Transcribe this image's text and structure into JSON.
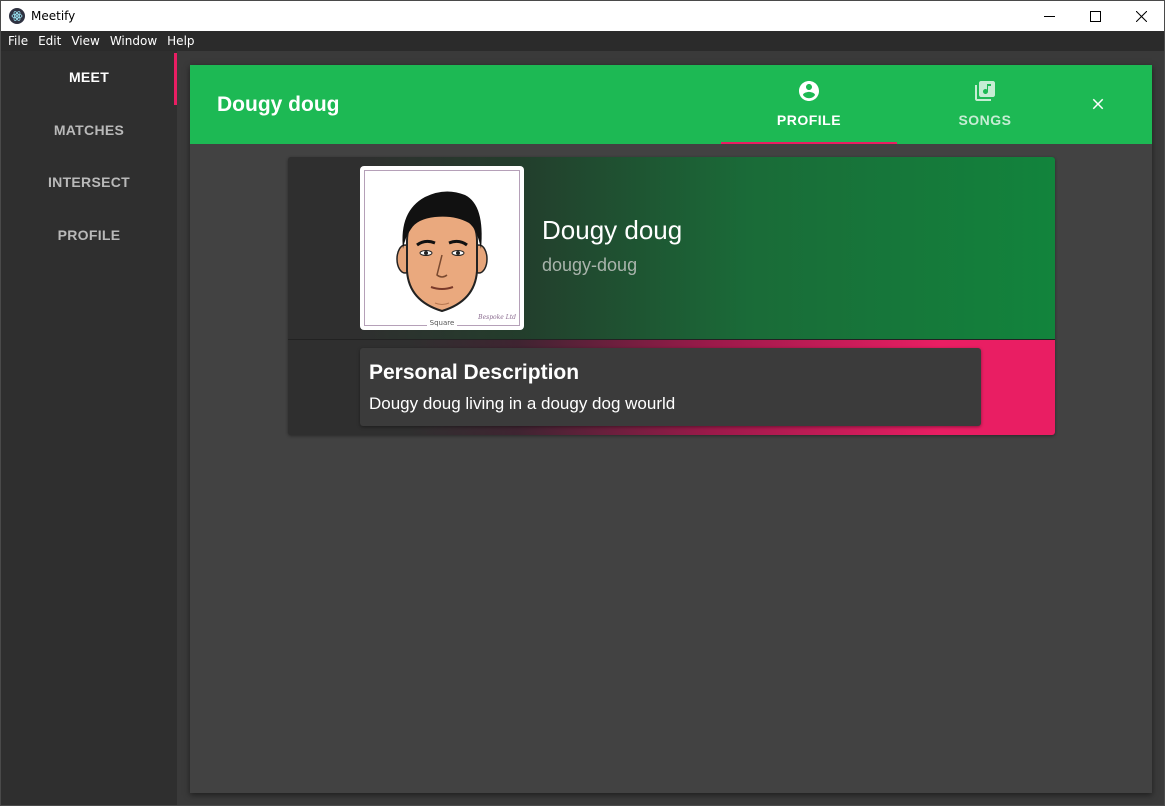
{
  "window": {
    "title": "Meetify",
    "app_icon": "electron-icon",
    "controls": [
      "minimize-icon",
      "maximize-icon",
      "close-icon"
    ]
  },
  "menu": {
    "items": [
      "File",
      "Edit",
      "View",
      "Window",
      "Help"
    ]
  },
  "sidebar": {
    "items": [
      {
        "label": "MEET",
        "active": true
      },
      {
        "label": "MATCHES",
        "active": false
      },
      {
        "label": "INTERSECT",
        "active": false
      },
      {
        "label": "PROFILE",
        "active": false
      }
    ],
    "indicator_color": "#e91e63"
  },
  "dialog": {
    "title": "Dougy doug",
    "header_color": "#1db954",
    "tabs": [
      {
        "label": "PROFILE",
        "icon": "account-circle-icon",
        "active": true
      },
      {
        "label": "SONGS",
        "icon": "library-music-icon",
        "active": false
      }
    ],
    "close_icon": "close-icon"
  },
  "profile": {
    "display_name": "Dougy doug",
    "username": "dougy-doug",
    "avatar": {
      "icon": "face-illustration",
      "caption": "Square",
      "signature": "Bespoke Ltd"
    },
    "description": {
      "title": "Personal Description",
      "text": "Dougy doug living in a dougy dog wourld"
    }
  },
  "colors": {
    "accent": "#e91e63",
    "brand_green": "#1db954"
  }
}
